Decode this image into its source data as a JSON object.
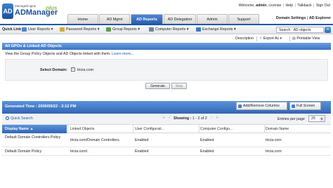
{
  "app": {
    "logo_small": "ManageEngine",
    "logo_main": "ADManager",
    "logo_plus": "plus",
    "logo_mark": "AD"
  },
  "toplinks": {
    "welcome": "Welcome,",
    "user": "admin",
    "license": "License",
    "help": "Help",
    "talkback": "Talkback",
    "signout": "Sign Out"
  },
  "tabs": [
    {
      "label": "Home"
    },
    {
      "label": "AD Mgmt"
    },
    {
      "label": "AD Reports"
    },
    {
      "label": "AD Delegation"
    },
    {
      "label": "Admin"
    },
    {
      "label": "Support"
    }
  ],
  "domain_settings": "Domain Settings",
  "ad_explorer": "AD Explorer",
  "quicklinks": {
    "label": "Quick Link :",
    "items": [
      {
        "label": "User Reports"
      },
      {
        "label": "Password Reports"
      },
      {
        "label": "Group Reports"
      },
      {
        "label": "Computer Reports"
      },
      {
        "label": "Exchange Reports"
      }
    ],
    "search_value": "Search : AD objects",
    "go": "»"
  },
  "actions": {
    "description": "Description",
    "export": "Export As",
    "printable": "Printable View"
  },
  "panel": {
    "title": "All GPOs & Linked AD Objects",
    "description": "View the Group Policy Objects and AD Objects linked with them.",
    "learn_more": "Learn more...",
    "select_domain_label": "Select Domain:",
    "domain_value": "tricia.com",
    "generate": "Generate",
    "stop": "Stop"
  },
  "results": {
    "generated": "Generated Time : 2006/09/22 - 3:12 PM",
    "add_remove_columns": "Add/Remove Columns",
    "full_screen": "Full Screen",
    "quick_search": "Quick Search",
    "showing_label": "Showing :",
    "showing_value": "1 - 2 of 2",
    "entries_label": "Entries per page",
    "entries_value": "25",
    "columns": [
      "Display Name",
      "Linked Objects",
      "User Configurati...",
      "Computer Configu...",
      "Domain Name"
    ],
    "sort_indicator": "▲",
    "rows": [
      {
        "name": "Default Domain Controllers Policy",
        "linked": "tricia.com/Domain Controllers.",
        "user": "Enabled",
        "computer": "Enabled",
        "domain": "tricia.com"
      },
      {
        "name": "Default Domain Policy",
        "linked": "tricia.com/.",
        "user": "Enabled",
        "computer": "Enabled",
        "domain": "tricia.com"
      }
    ]
  },
  "colors": {
    "accent_blue": "#2b62b3",
    "header_blue": "#3d73c2",
    "link_blue": "#2356a8"
  }
}
